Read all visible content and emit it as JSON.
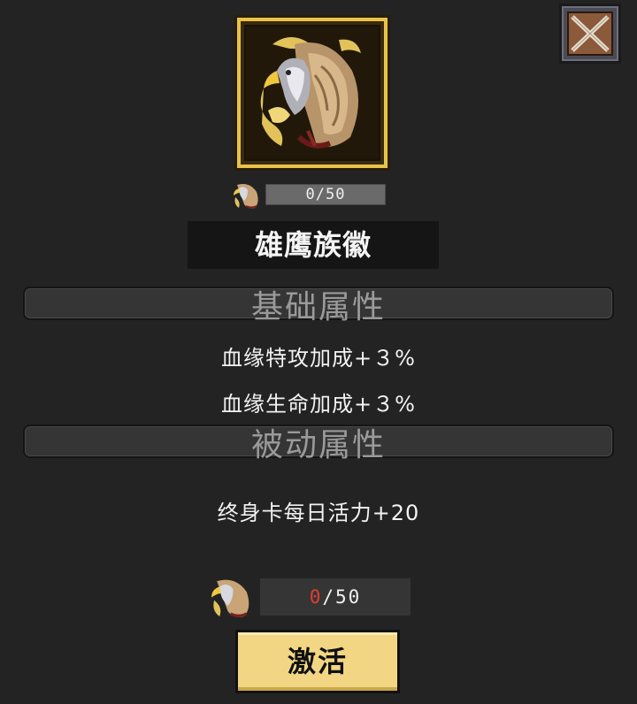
{
  "emblem": {
    "name": "雄鹰族徽",
    "icon": "eagle-emblem-icon"
  },
  "top_progress": {
    "text": "0/50",
    "current": 0,
    "max": 50
  },
  "base_section": {
    "title": "基础属性",
    "attributes": [
      "血缘特攻加成+３%",
      "血缘生命加成+３%"
    ]
  },
  "passive_section": {
    "title": "被动属性",
    "attributes": [
      "终身卡每日活力+20"
    ]
  },
  "bottom_progress": {
    "have": "0",
    "separator_total": "/50"
  },
  "activate_button": {
    "label": "激活"
  },
  "close_button": {
    "icon": "close-icon"
  },
  "colors": {
    "gold_frame": "#e8c34a",
    "activate_bg": "#f2d683",
    "insufficient_red": "#e04030"
  }
}
